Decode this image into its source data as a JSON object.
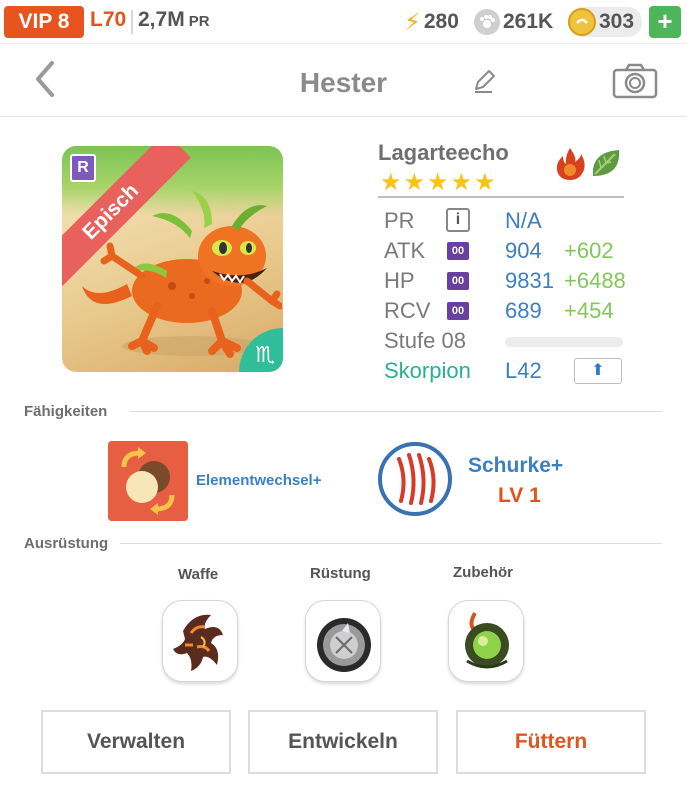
{
  "topbar": {
    "vip": "VIP 8",
    "level": "L70",
    "pr_value": "2,7M",
    "pr_unit": "PR",
    "energy": "280",
    "paws": "261K",
    "coins": "303",
    "add_label": "+"
  },
  "header": {
    "title": "Hester",
    "back_icon": "chevron-left-icon",
    "edit_icon": "pencil-icon",
    "camera_icon": "camera-icon"
  },
  "monster": {
    "rarity": "Episch",
    "r_badge": "R",
    "zodiac_glyph": "♏",
    "species": "Lagarteecho",
    "stars": "★★★★★",
    "star_count": 5,
    "elements": [
      "fire",
      "leaf"
    ]
  },
  "stats": {
    "pr": {
      "label": "PR",
      "info": "i",
      "value": "N/A"
    },
    "atk": {
      "label": "ATK",
      "badge": "00",
      "value": "904",
      "bonus": "+602"
    },
    "hp": {
      "label": "HP",
      "badge": "00",
      "value": "9831",
      "bonus": "+6488"
    },
    "rcv": {
      "label": "RCV",
      "badge": "00",
      "value": "689",
      "bonus": "+454"
    },
    "level": {
      "label": "Stufe 08",
      "progress": 0
    },
    "sign": {
      "name": "Skorpion",
      "level": "L42",
      "up_icon": "⬆"
    }
  },
  "skills": {
    "title": "Fähigkeiten",
    "skill1": {
      "name": "Elementwechsel+"
    },
    "skill2": {
      "name": "Schurke+",
      "level": "LV 1"
    }
  },
  "equipment": {
    "title": "Ausrüstung",
    "weapon": "Waffe",
    "armor": "Rüstung",
    "accessory": "Zubehör"
  },
  "buttons": {
    "manage": "Verwalten",
    "evolve": "Entwickeln",
    "feed": "Füttern"
  },
  "colors": {
    "accent_orange": "#e0541e",
    "blue": "#3d7fc2",
    "green": "#83c75a",
    "teal": "#2ab090",
    "purple": "#6a3fa2"
  }
}
